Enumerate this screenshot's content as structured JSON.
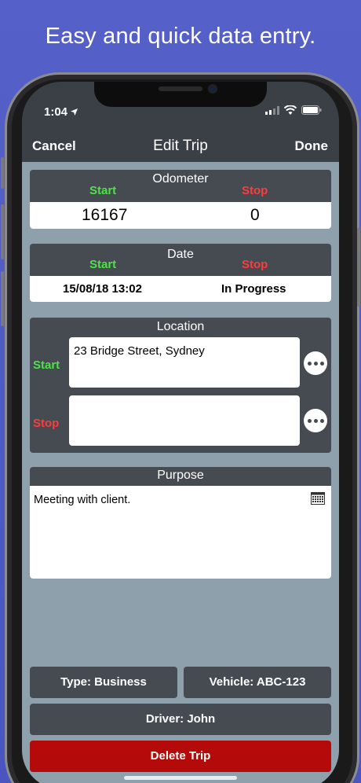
{
  "tagline": "Easy and quick data entry.",
  "status_bar": {
    "time": "1:04"
  },
  "navbar": {
    "cancel": "Cancel",
    "title": "Edit Trip",
    "done": "Done"
  },
  "odometer": {
    "title": "Odometer",
    "start_label": "Start",
    "stop_label": "Stop",
    "start_value": "16167",
    "stop_value": "0"
  },
  "date": {
    "title": "Date",
    "start_label": "Start",
    "stop_label": "Stop",
    "start_value": "15/08/18 13:02",
    "stop_value": "In Progress"
  },
  "location": {
    "title": "Location",
    "start_label": "Start",
    "stop_label": "Stop",
    "start_value": "23 Bridge Street, Sydney",
    "stop_value": ""
  },
  "purpose": {
    "title": "Purpose",
    "value": "Meeting with client."
  },
  "buttons": {
    "type": "Type: Business",
    "vehicle": "Vehicle: ABC-123",
    "driver": "Driver: John",
    "delete": "Delete Trip"
  },
  "colors": {
    "start": "#4fe04a",
    "stop": "#ff3b3b",
    "delete": "#b40a0a",
    "panel": "#464b52",
    "background": "#8fa0ad"
  },
  "icons": [
    "location-arrow-icon",
    "signal-icon",
    "wifi-icon",
    "battery-icon",
    "more-icon",
    "calendar-icon"
  ]
}
